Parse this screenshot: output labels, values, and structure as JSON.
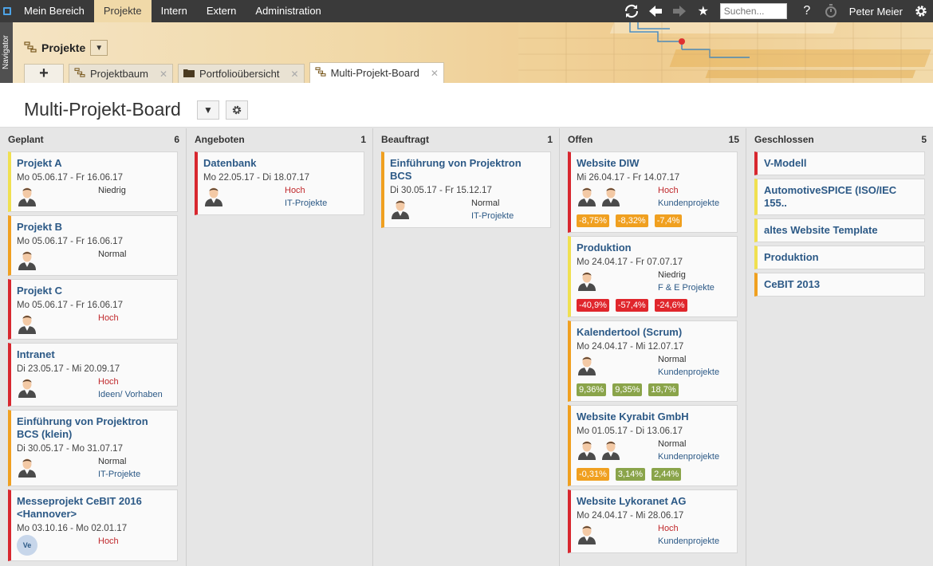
{
  "nav": {
    "items": [
      "Mein Bereich",
      "Projekte",
      "Intern",
      "Extern",
      "Administration"
    ],
    "active_index": 1,
    "search_placeholder": "Suchen...",
    "help": "?",
    "user": "Peter Meier"
  },
  "navigator_label": "Navigator",
  "header": {
    "title": "Projekte",
    "tabs": [
      "Projektbaum",
      "Portfolioübersicht",
      "Multi-Projekt-Board"
    ],
    "add_label": "+"
  },
  "page": {
    "title": "Multi-Projekt-Board"
  },
  "columns": [
    {
      "name": "Geplant",
      "count": "6",
      "cards": [
        {
          "title": "Projekt A",
          "dates": "Mo 05.06.17 - Fr 16.06.17",
          "border": "yellow",
          "prio": "Niedrig",
          "prio_high": false,
          "category": "",
          "avatars": 1
        },
        {
          "title": "Projekt B",
          "dates": "Mo 05.06.17 - Fr 16.06.17",
          "border": "orange",
          "prio": "Normal",
          "prio_high": false,
          "category": "",
          "avatars": 1
        },
        {
          "title": "Projekt C",
          "dates": "Mo 05.06.17 - Fr 16.06.17",
          "border": "red",
          "prio": "Hoch",
          "prio_high": true,
          "category": "",
          "avatars": 1
        },
        {
          "title": "Intranet",
          "dates": "Di 23.05.17 - Mi 20.09.17",
          "border": "red",
          "prio": "Hoch",
          "prio_high": true,
          "category": "Ideen/ Vorhaben",
          "avatars": 1
        },
        {
          "title": "Einführung von Projektron BCS (klein)",
          "dates": "Di 30.05.17 - Mo 31.07.17",
          "border": "orange",
          "prio": "Normal",
          "prio_high": false,
          "category": "IT-Projekte",
          "avatars": 1
        },
        {
          "title": "Messeprojekt CeBIT 2016 <Hannover>",
          "dates": "Mo 03.10.16 - Mo 02.01.17",
          "border": "red",
          "prio": "Hoch",
          "prio_high": true,
          "category": "",
          "avatars": 0,
          "initials": "Ve"
        }
      ]
    },
    {
      "name": "Angeboten",
      "count": "1",
      "cards": [
        {
          "title": "Datenbank",
          "dates": "Mo 22.05.17 - Di 18.07.17",
          "border": "red",
          "prio": "Hoch",
          "prio_high": true,
          "category": "IT-Projekte",
          "avatars": 1
        }
      ]
    },
    {
      "name": "Beauftragt",
      "count": "1",
      "cards": [
        {
          "title": "Einführung von Projektron BCS",
          "dates": "Di 30.05.17 - Fr 15.12.17",
          "border": "orange",
          "prio": "Normal",
          "prio_high": false,
          "category": "IT-Projekte",
          "avatars": 1
        }
      ]
    },
    {
      "name": "Offen",
      "count": "15",
      "cards": [
        {
          "title": "Website DIW",
          "dates": "Mi 26.04.17 - Fr 14.07.17",
          "border": "red",
          "prio": "Hoch",
          "prio_high": true,
          "category": "Kundenprojekte",
          "avatars": 2,
          "badges": [
            {
              "v": "-8,75%",
              "c": "orange"
            },
            {
              "v": "-8,32%",
              "c": "orange"
            },
            {
              "v": "-7,4%",
              "c": "orange"
            }
          ]
        },
        {
          "title": "Produktion",
          "dates": "Mo 24.04.17 - Fr 07.07.17",
          "border": "yellow",
          "prio": "Niedrig",
          "prio_high": false,
          "category": "F & E Projekte",
          "avatars": 1,
          "badges": [
            {
              "v": "-40,9%",
              "c": "red"
            },
            {
              "v": "-57,4%",
              "c": "red"
            },
            {
              "v": "-24,6%",
              "c": "red"
            }
          ]
        },
        {
          "title": "Kalendertool (Scrum)",
          "dates": "Mo 24.04.17 - Mi 12.07.17",
          "border": "orange",
          "prio": "Normal",
          "prio_high": false,
          "category": "Kundenprojekte",
          "avatars": 1,
          "badges": [
            {
              "v": "9,36%",
              "c": "green"
            },
            {
              "v": "9,35%",
              "c": "green"
            },
            {
              "v": "18,7%",
              "c": "green"
            }
          ]
        },
        {
          "title": "Website Kyrabit GmbH",
          "dates": "Mo 01.05.17 - Di 13.06.17",
          "border": "orange",
          "prio": "Normal",
          "prio_high": false,
          "category": "Kundenprojekte",
          "avatars": 2,
          "badges": [
            {
              "v": "-0,31%",
              "c": "orange"
            },
            {
              "v": "3,14%",
              "c": "green"
            },
            {
              "v": "2,44%",
              "c": "green"
            }
          ]
        },
        {
          "title": "Website Lykoranet AG",
          "dates": "Mo 24.04.17 - Mi 28.06.17",
          "border": "red",
          "prio": "Hoch",
          "prio_high": true,
          "category": "Kundenprojekte",
          "avatars": 1
        }
      ]
    },
    {
      "name": "Geschlossen",
      "count": "5",
      "cards": [
        {
          "title": "V-Modell",
          "border": "red"
        },
        {
          "title": "AutomotiveSPICE (ISO/IEC 155..",
          "border": "yellow"
        },
        {
          "title": "altes Website Template",
          "border": "yellow"
        },
        {
          "title": "Produktion",
          "border": "yellow"
        },
        {
          "title": "CeBIT 2013",
          "border": "orange"
        }
      ]
    }
  ]
}
